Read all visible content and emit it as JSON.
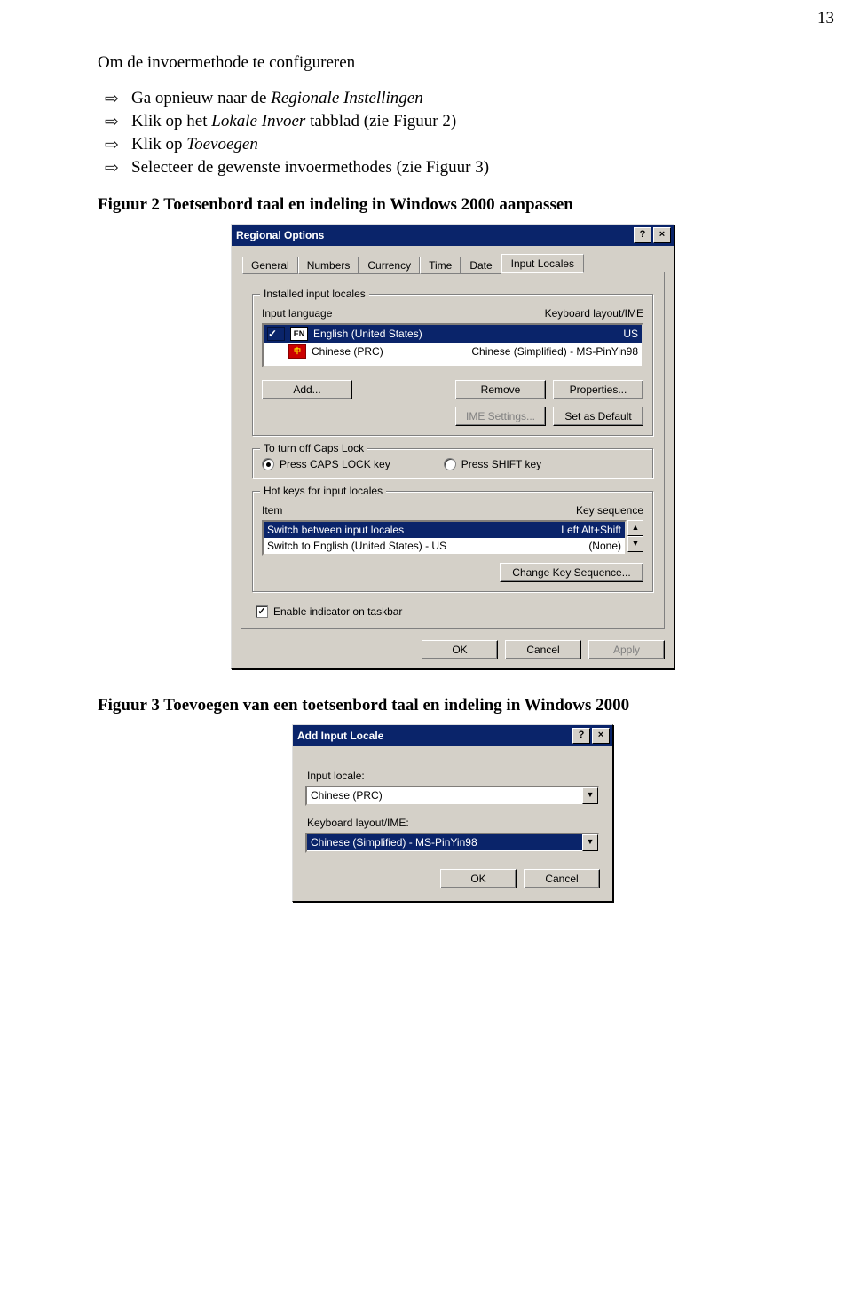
{
  "page_number": "13",
  "section_title": "Om de invoermethode te configureren",
  "bullets": [
    {
      "pre": "Ga opnieuw naar de ",
      "em": "Regionale Instellingen",
      "post": ""
    },
    {
      "pre": "Klik op het ",
      "em": "Lokale Invoer",
      "post": " tabblad (zie Figuur 2)"
    },
    {
      "pre": "Klik op ",
      "em": "Toevoegen",
      "post": ""
    },
    {
      "pre": "Selecteer de gewenste invoermethodes (zie Figuur 3)",
      "em": "",
      "post": ""
    }
  ],
  "fig2_caption": "Figuur 2 Toetsenbord taal en indeling in Windows 2000 aanpassen",
  "fig3_caption": "Figuur 3 Toevoegen van een toetsenbord taal en indeling in Windows 2000",
  "dlg1": {
    "title": "Regional Options",
    "help_btn": "?",
    "close_btn": "×",
    "tabs": [
      "General",
      "Numbers",
      "Currency",
      "Time",
      "Date",
      "Input Locales"
    ],
    "group1_legend": "Installed input locales",
    "col_left": "Input language",
    "col_right": "Keyboard layout/IME",
    "list": [
      {
        "badge": "EN",
        "lang": "English (United States)",
        "kb": "US",
        "selected": true,
        "default": true
      },
      {
        "badge": "中",
        "lang": "Chinese (PRC)",
        "kb": "Chinese (Simplified) - MS-PinYin98",
        "selected": false,
        "default": false
      }
    ],
    "btn_add": "Add...",
    "btn_remove": "Remove",
    "btn_props": "Properties...",
    "btn_ime": "IME Settings...",
    "btn_default": "Set as Default",
    "group2_legend": "To turn off Caps Lock",
    "radio_caps": "Press CAPS LOCK key",
    "radio_shift": "Press SHIFT key",
    "group3_legend": "Hot keys for input locales",
    "hot_col_left": "Item",
    "hot_col_right": "Key sequence",
    "hot_rows": [
      {
        "item": "Switch between input locales",
        "seq": "Left Alt+Shift",
        "selected": true
      },
      {
        "item": "Switch to English (United States) - US",
        "seq": "(None)",
        "selected": false
      }
    ],
    "btn_changeseq": "Change Key Sequence...",
    "chk_indicator": "Enable indicator on taskbar",
    "btn_ok": "OK",
    "btn_cancel": "Cancel",
    "btn_apply": "Apply"
  },
  "dlg2": {
    "title": "Add Input Locale",
    "help_btn": "?",
    "close_btn": "×",
    "label_locale": "Input locale:",
    "value_locale": "Chinese (PRC)",
    "label_kb": "Keyboard layout/IME:",
    "value_kb": "Chinese (Simplified) - MS-PinYin98",
    "btn_ok": "OK",
    "btn_cancel": "Cancel"
  }
}
